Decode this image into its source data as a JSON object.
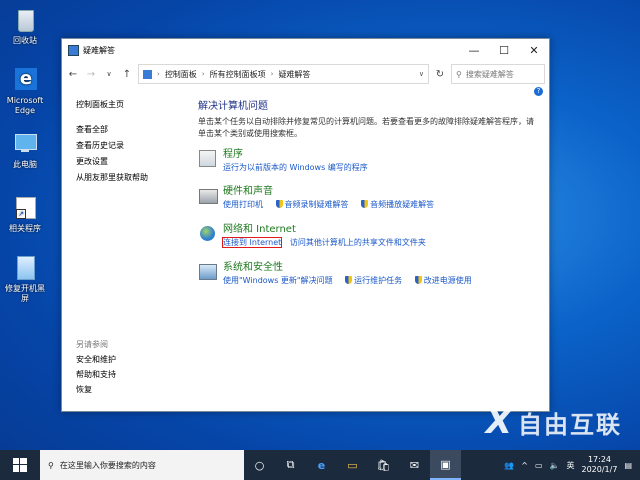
{
  "desktop": {
    "icons": [
      {
        "label": "回收站"
      },
      {
        "label": "Microsoft Edge"
      },
      {
        "label": "此电脑"
      },
      {
        "label": "相关程序"
      },
      {
        "label": "修复开机黑屏"
      }
    ]
  },
  "window": {
    "title": "疑难解答",
    "controls": {
      "minimize": "—",
      "maximize": "☐",
      "close": "✕"
    },
    "address": {
      "crumbs": [
        "控制面板",
        "所有控制面板项",
        "疑难解答"
      ]
    },
    "search_placeholder": "搜索疑难解答",
    "help_glyph": "?"
  },
  "left_pane": {
    "links": [
      "控制面板主页",
      "查看全部",
      "查看历史记录",
      "更改设置",
      "从朋友那里获取帮助"
    ],
    "see_also_heading": "另请参阅",
    "see_also": [
      "安全和维护",
      "帮助和支持",
      "恢复"
    ]
  },
  "main": {
    "heading": "解决计算机问题",
    "description": "单击某个任务以自动排除并修复常见的计算机问题。若要查看更多的故障排除疑难解答程序，请单击某个类别或使用搜索框。",
    "categories": [
      {
        "name": "程序",
        "links": [
          "运行为以前版本的 Windows 编写的程序"
        ]
      },
      {
        "name": "硬件和声音",
        "links": [
          "使用打印机",
          "音频录制疑难解答",
          "音频播放疑难解答"
        ]
      },
      {
        "name": "网络和 Internet",
        "links": [
          "连接到 Internet",
          "访问其他计算机上的共享文件和文件夹"
        ]
      },
      {
        "name": "系统和安全性",
        "links": [
          "使用\"Windows 更新\"解决问题",
          "运行维护任务",
          "改进电源使用"
        ]
      }
    ]
  },
  "taskbar": {
    "search_placeholder": "在这里输入你要搜索的内容",
    "ime": "英",
    "time": "17:24",
    "date": "2020/1/7"
  },
  "watermark": {
    "text": "自由互联",
    "mark": "X"
  }
}
